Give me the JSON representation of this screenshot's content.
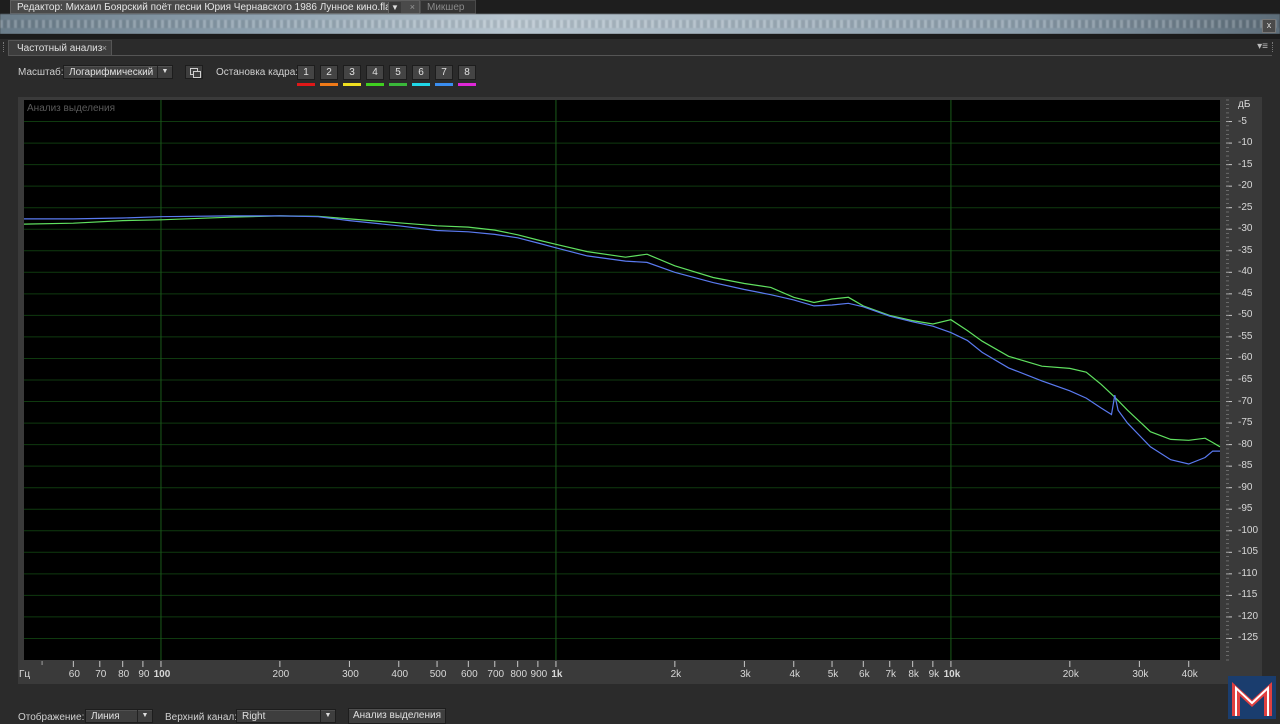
{
  "tabs": {
    "editor_label": "Редактор: Михаил Боярский поёт песни Юрия Чернавского 1986 Лунное кино.flac",
    "editor_close": "×",
    "mixer_label": "Микшер",
    "window_close": "x"
  },
  "panel": {
    "title": "Частотный анализ",
    "close": "×",
    "menu_icon": "▾≡"
  },
  "controls": {
    "scale_label": "Масштаб:",
    "scale_value": "Логарифмический",
    "freeze_label": "Остановка кадра:",
    "frames": [
      {
        "label": "1",
        "color": "#e01818"
      },
      {
        "label": "2",
        "color": "#f07a18"
      },
      {
        "label": "3",
        "color": "#f0e020"
      },
      {
        "label": "4",
        "color": "#40d020"
      },
      {
        "label": "5",
        "color": "#3ab83a"
      },
      {
        "label": "6",
        "color": "#20d8e8"
      },
      {
        "label": "7",
        "color": "#3a8ef0"
      },
      {
        "label": "8",
        "color": "#e028d8"
      }
    ]
  },
  "plot": {
    "overlay_label": "Анализ выделения",
    "y_unit": "дБ",
    "x_unit": "Гц"
  },
  "chart_data": {
    "type": "line",
    "xscale": "log",
    "xlim": [
      45,
      48000
    ],
    "ylim": [
      -130,
      0
    ],
    "ylabel": "дБ",
    "xlabel": "Гц",
    "grid": true,
    "x_ticks": [
      {
        "v": 60,
        "label": "60"
      },
      {
        "v": 70,
        "label": "70"
      },
      {
        "v": 80,
        "label": "80"
      },
      {
        "v": 90,
        "label": "90"
      },
      {
        "v": 100,
        "label": "100",
        "bold": true
      },
      {
        "v": 200,
        "label": "200"
      },
      {
        "v": 300,
        "label": "300"
      },
      {
        "v": 400,
        "label": "400"
      },
      {
        "v": 500,
        "label": "500"
      },
      {
        "v": 600,
        "label": "600"
      },
      {
        "v": 700,
        "label": "700"
      },
      {
        "v": 800,
        "label": "800"
      },
      {
        "v": 900,
        "label": "900"
      },
      {
        "v": 1000,
        "label": "1k",
        "bold": true
      },
      {
        "v": 2000,
        "label": "2k"
      },
      {
        "v": 3000,
        "label": "3k"
      },
      {
        "v": 4000,
        "label": "4k"
      },
      {
        "v": 5000,
        "label": "5k"
      },
      {
        "v": 6000,
        "label": "6k"
      },
      {
        "v": 7000,
        "label": "7k"
      },
      {
        "v": 8000,
        "label": "8k"
      },
      {
        "v": 9000,
        "label": "9k"
      },
      {
        "v": 10000,
        "label": "10k",
        "bold": true
      },
      {
        "v": 20000,
        "label": "20k"
      },
      {
        "v": 30000,
        "label": "30k"
      },
      {
        "v": 40000,
        "label": "40k"
      }
    ],
    "y_ticks": [
      -5,
      -10,
      -15,
      -20,
      -25,
      -30,
      -35,
      -40,
      -45,
      -50,
      -55,
      -60,
      -65,
      -70,
      -75,
      -80,
      -85,
      -90,
      -95,
      -100,
      -105,
      -110,
      -115,
      -120,
      -125
    ],
    "series": [
      {
        "color": "#60e060",
        "points": [
          [
            45,
            -28.8
          ],
          [
            60,
            -28.6
          ],
          [
            80,
            -28.0
          ],
          [
            100,
            -27.8
          ],
          [
            150,
            -27.2
          ],
          [
            200,
            -26.9
          ],
          [
            250,
            -27.0
          ],
          [
            300,
            -27.6
          ],
          [
            400,
            -28.5
          ],
          [
            500,
            -29.2
          ],
          [
            600,
            -29.5
          ],
          [
            700,
            -30.2
          ],
          [
            800,
            -31.3
          ],
          [
            900,
            -32.5
          ],
          [
            1000,
            -33.5
          ],
          [
            1200,
            -35.2
          ],
          [
            1500,
            -36.5
          ],
          [
            1700,
            -35.8
          ],
          [
            2000,
            -38.5
          ],
          [
            2500,
            -41.2
          ],
          [
            3000,
            -42.6
          ],
          [
            3500,
            -43.5
          ],
          [
            4000,
            -45.8
          ],
          [
            4500,
            -47.0
          ],
          [
            5000,
            -46.2
          ],
          [
            5500,
            -45.8
          ],
          [
            6000,
            -47.8
          ],
          [
            7000,
            -50.0
          ],
          [
            8000,
            -51.2
          ],
          [
            9000,
            -52.0
          ],
          [
            10000,
            -51.0
          ],
          [
            11000,
            -53.5
          ],
          [
            12000,
            -56.0
          ],
          [
            14000,
            -59.5
          ],
          [
            17000,
            -61.8
          ],
          [
            20000,
            -62.3
          ],
          [
            22000,
            -63.2
          ],
          [
            24000,
            -66.0
          ],
          [
            26000,
            -69.0
          ],
          [
            28000,
            -72.0
          ],
          [
            32000,
            -77.0
          ],
          [
            36000,
            -78.8
          ],
          [
            40000,
            -79.0
          ],
          [
            44000,
            -78.5
          ],
          [
            46000,
            -79.5
          ],
          [
            48000,
            -80.5
          ]
        ]
      },
      {
        "color": "#5a7af0",
        "points": [
          [
            45,
            -27.6
          ],
          [
            60,
            -27.6
          ],
          [
            80,
            -27.4
          ],
          [
            100,
            -27.1
          ],
          [
            150,
            -26.9
          ],
          [
            200,
            -26.9
          ],
          [
            250,
            -27.1
          ],
          [
            300,
            -28.0
          ],
          [
            400,
            -29.2
          ],
          [
            500,
            -30.3
          ],
          [
            600,
            -30.6
          ],
          [
            700,
            -31.2
          ],
          [
            800,
            -32.0
          ],
          [
            900,
            -33.2
          ],
          [
            1000,
            -34.3
          ],
          [
            1200,
            -36.2
          ],
          [
            1500,
            -37.4
          ],
          [
            1700,
            -37.7
          ],
          [
            2000,
            -40.0
          ],
          [
            2500,
            -42.4
          ],
          [
            3000,
            -44.0
          ],
          [
            3500,
            -45.2
          ],
          [
            4000,
            -46.4
          ],
          [
            4500,
            -47.8
          ],
          [
            5000,
            -47.6
          ],
          [
            5500,
            -47.2
          ],
          [
            6000,
            -48.0
          ],
          [
            7000,
            -50.2
          ],
          [
            8000,
            -51.5
          ],
          [
            9000,
            -52.5
          ],
          [
            10000,
            -54.0
          ],
          [
            11000,
            -55.8
          ],
          [
            12000,
            -58.6
          ],
          [
            14000,
            -62.2
          ],
          [
            17000,
            -65.2
          ],
          [
            20000,
            -67.5
          ],
          [
            22000,
            -69.2
          ],
          [
            24000,
            -71.5
          ],
          [
            25500,
            -73.0
          ],
          [
            26000,
            -68.5
          ],
          [
            26500,
            -72.0
          ],
          [
            28000,
            -75.0
          ],
          [
            32000,
            -80.5
          ],
          [
            36000,
            -83.5
          ],
          [
            40000,
            -84.5
          ],
          [
            44000,
            -83.0
          ],
          [
            46000,
            -81.5
          ],
          [
            48000,
            -81.5
          ]
        ]
      }
    ]
  },
  "bottom": {
    "display_label": "Отображение:",
    "display_value": "Линия",
    "channel_label": "Верхний канал:",
    "channel_value": "Right",
    "analyze_button": "Анализ выделения"
  }
}
